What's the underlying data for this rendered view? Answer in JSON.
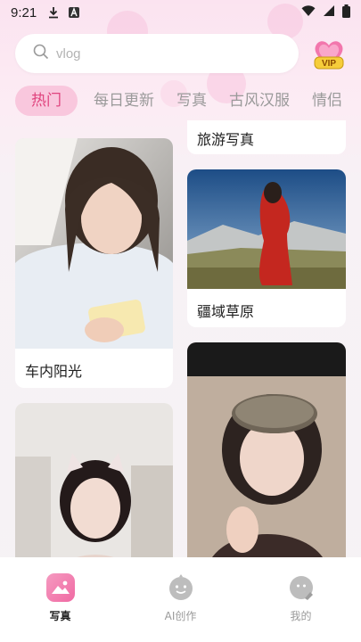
{
  "status_bar": {
    "time": "9:21"
  },
  "search": {
    "placeholder": "vlog"
  },
  "vip": {
    "label": "VIP"
  },
  "tabs": [
    {
      "label": "热门",
      "active": true
    },
    {
      "label": "每日更新",
      "active": false
    },
    {
      "label": "写真",
      "active": false
    },
    {
      "label": "古风汉服",
      "active": false
    },
    {
      "label": "情侣",
      "active": false
    }
  ],
  "feed": {
    "left": [
      {
        "caption": "车内阳光"
      },
      {
        "caption": ""
      }
    ],
    "right": [
      {
        "caption": "旅游写真"
      },
      {
        "caption": "疆域草原"
      },
      {
        "caption": ""
      }
    ]
  },
  "bottom_nav": [
    {
      "label": "写真",
      "active": true
    },
    {
      "label": "AI创作",
      "active": false
    },
    {
      "label": "我的",
      "active": false
    }
  ],
  "colors": {
    "accent": "#e0447e",
    "tab_active_bg": "#f9c7dd"
  }
}
